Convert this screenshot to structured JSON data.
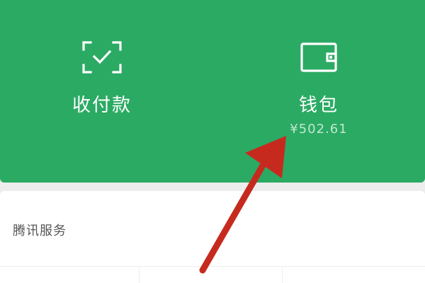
{
  "wallet_panel": {
    "background_color": "#2baa63",
    "payment": {
      "icon": "scan-check-icon",
      "label": "收付款"
    },
    "wallet": {
      "icon": "wallet-icon",
      "label": "钱包",
      "balance": "¥502.61"
    }
  },
  "services": {
    "title": "腾讯服务"
  },
  "annotation": {
    "arrow_color": "#c62a1f"
  }
}
